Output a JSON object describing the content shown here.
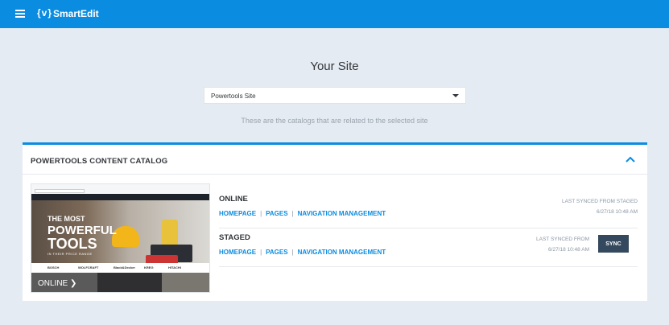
{
  "app": {
    "title": "SmartEdit",
    "logo_glyph": "{v}"
  },
  "header": {
    "menu_icon": "hamburger-icon"
  },
  "page": {
    "title": "Your Site",
    "site_select": {
      "value": "Powertools Site"
    },
    "helper_text": "These are the catalogs that are related to the selected site"
  },
  "catalog": {
    "title": "POWERTOOLS CONTENT CATALOG",
    "thumbnail": {
      "hero_line1": "THE MOST",
      "hero_line2": "POWERFUL",
      "hero_line3": "TOOLS",
      "hero_tag": "IN THEIR PRICE RANGE",
      "brands": [
        "BOSCH",
        "WOLFCRAFT",
        "Black&Decker",
        "KREG",
        "HITACHI"
      ],
      "online_label": "ONLINE ❯"
    },
    "versions": [
      {
        "name": "ONLINE",
        "links": [
          "HOMEPAGE",
          "PAGES",
          "NAVIGATION MANAGEMENT"
        ],
        "sync_label": "LAST SYNCED FROM STAGED",
        "sync_date": "6/27/18 10:48 AM"
      },
      {
        "name": "STAGED",
        "links": [
          "HOMEPAGE",
          "PAGES",
          "NAVIGATION MANAGEMENT"
        ],
        "sync_label": "LAST SYNCED FROM",
        "sync_date": "6/27/18 10:48 AM",
        "sync_button": "SYNC"
      }
    ]
  },
  "colors": {
    "brand_blue": "#0a8ce0",
    "sync_button": "#34495e",
    "background": "#e5ebf2"
  }
}
